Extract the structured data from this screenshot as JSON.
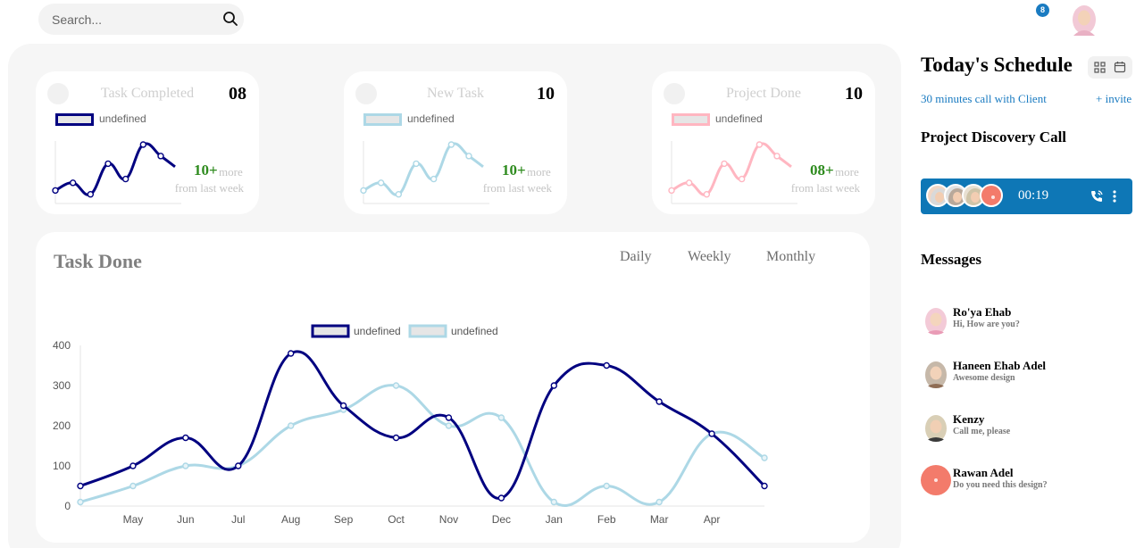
{
  "search": {
    "placeholder": "Search..."
  },
  "notifications": {
    "count": "8"
  },
  "stat_cards": [
    {
      "title": "Task Completed",
      "count": "08",
      "legend": "undefined",
      "percent": "10+",
      "more": "more",
      "from": "from last week",
      "color": "#000080"
    },
    {
      "title": "New Task",
      "count": "10",
      "legend": "undefined",
      "percent": "10+",
      "more": "more",
      "from": "from last week",
      "color": "#add8e6"
    },
    {
      "title": "Project Done",
      "count": "10",
      "legend": "undefined",
      "percent": "08+",
      "more": "more",
      "from": "from last week",
      "color": "#ffb6c1"
    }
  ],
  "task_done": {
    "title": "Task Done",
    "periods": [
      "Daily",
      "Weekly",
      "Monthly"
    ]
  },
  "schedule": {
    "title": "Today's Schedule",
    "call_text": "30 minutes call with Client",
    "invite": "+ invite",
    "project_title": "Project Discovery Call",
    "timer": "00:19",
    "messages_title": "Messages",
    "messages": [
      {
        "name": "Ro'ya Ehab",
        "text": "Hi, How are you?"
      },
      {
        "name": "Haneen Ehab Adel",
        "text": "Awesome design"
      },
      {
        "name": "Kenzy",
        "text": "Call me, please"
      },
      {
        "name": "Rawan Adel",
        "text": "Do you need this design?"
      }
    ]
  },
  "chart_data": [
    {
      "type": "line",
      "x": [
        1,
        2,
        3,
        4,
        5,
        6,
        7
      ],
      "series": [
        {
          "name": "undefined",
          "values": [
            10,
            20,
            5,
            45,
            25,
            70,
            55
          ]
        }
      ],
      "color": "#000080"
    },
    {
      "type": "line",
      "x": [
        1,
        2,
        3,
        4,
        5,
        6,
        7
      ],
      "series": [
        {
          "name": "undefined",
          "values": [
            10,
            20,
            5,
            45,
            25,
            70,
            55
          ]
        }
      ],
      "color": "#add8e6"
    },
    {
      "type": "line",
      "x": [
        1,
        2,
        3,
        4,
        5,
        6,
        7
      ],
      "series": [
        {
          "name": "undefined",
          "values": [
            10,
            20,
            5,
            45,
            25,
            70,
            55
          ]
        }
      ],
      "color": "#ffb6c1"
    },
    {
      "type": "line",
      "categories": [
        "",
        "May",
        "Jun",
        "Jul",
        "Aug",
        "Sep",
        "Oct",
        "Nov",
        "Dec",
        "Jan",
        "Feb",
        "Mar",
        "Apr",
        ""
      ],
      "series": [
        {
          "name": "undefined",
          "color": "#000080",
          "values": [
            50,
            100,
            170,
            100,
            380,
            250,
            170,
            220,
            20,
            300,
            350,
            260,
            180,
            50
          ]
        },
        {
          "name": "undefined",
          "color": "#add8e6",
          "values": [
            10,
            50,
            100,
            100,
            200,
            240,
            300,
            200,
            220,
            10,
            50,
            10,
            180,
            120
          ]
        }
      ],
      "yticks": [
        0,
        100,
        200,
        300,
        400
      ],
      "ylim": [
        0,
        400
      ],
      "legend": "top",
      "grid": false
    }
  ]
}
